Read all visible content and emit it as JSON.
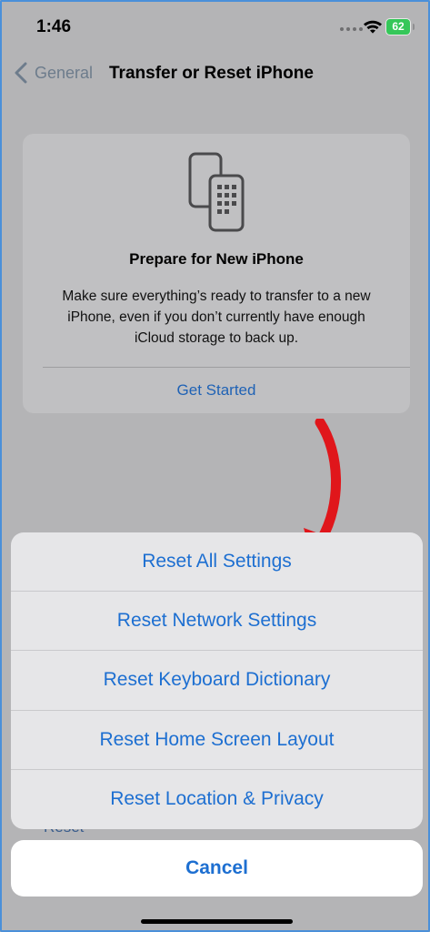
{
  "status": {
    "time": "1:46",
    "battery": "62"
  },
  "nav": {
    "back_label": "General",
    "title": "Transfer or Reset iPhone"
  },
  "prepare_card": {
    "title": "Prepare for New iPhone",
    "description": "Make sure everything’s ready to transfer to a new iPhone, even if you don’t currently have enough iCloud storage to back up.",
    "action": "Get Started"
  },
  "background": {
    "reset_label": "Reset"
  },
  "action_sheet": {
    "items": [
      "Reset All Settings",
      "Reset Network Settings",
      "Reset Keyboard Dictionary",
      "Reset Home Screen Layout",
      "Reset Location & Privacy"
    ],
    "cancel": "Cancel"
  },
  "colors": {
    "accent": "#1d6fd1",
    "annotation_arrow": "#e0161b",
    "battery": "#35c759"
  },
  "icons": [
    "chevron-left-icon",
    "wifi-icon",
    "battery-icon",
    "two-phones-icon"
  ]
}
